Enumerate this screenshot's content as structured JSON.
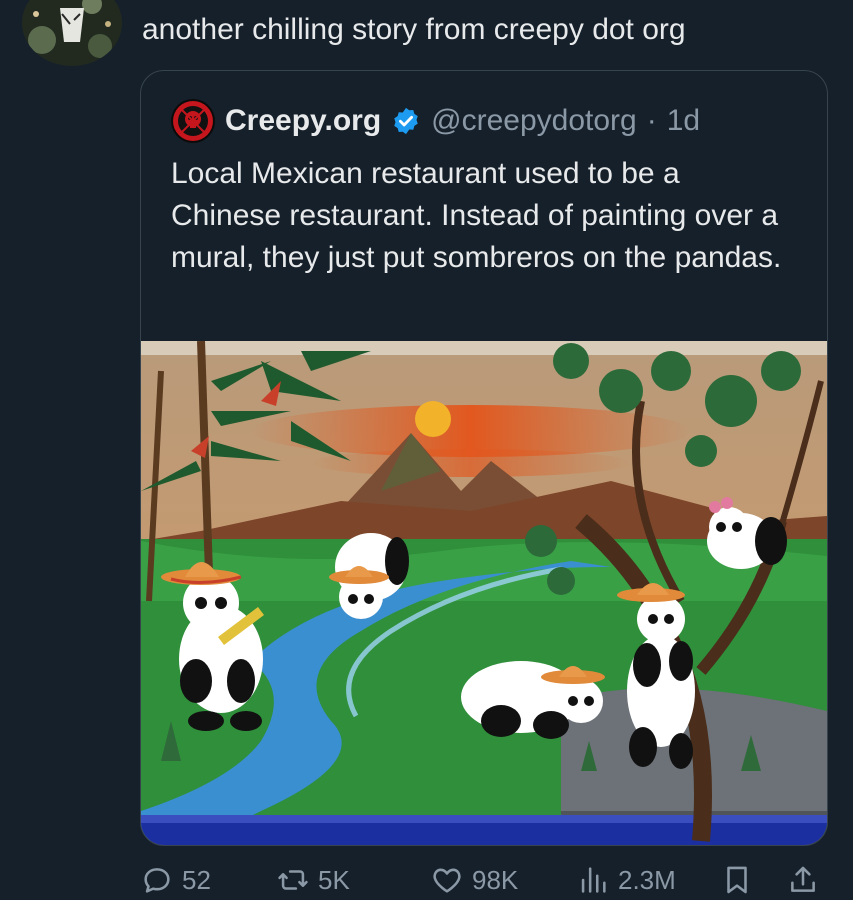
{
  "post": {
    "text": "another chilling story from creepy dot org"
  },
  "quote": {
    "name": "Creepy.org",
    "handle": "@creepydotorg",
    "separator": "·",
    "time": "1d",
    "body": "Local Mexican restaurant used to be a Chinese restaurant. Instead of painting over a mural, they just put sombreros on the pandas."
  },
  "actions": {
    "replies": "52",
    "reposts": "5K",
    "likes": "98K",
    "views": "2.3M"
  },
  "colors": {
    "background": "#15202b",
    "text": "#e7e9ea",
    "muted": "#8b98a5",
    "border": "#38444d",
    "verified": "#1d9bf0"
  },
  "icons": [
    "reply-icon",
    "repost-icon",
    "like-icon",
    "views-icon",
    "bookmark-icon",
    "share-icon",
    "verified-badge-icon"
  ]
}
